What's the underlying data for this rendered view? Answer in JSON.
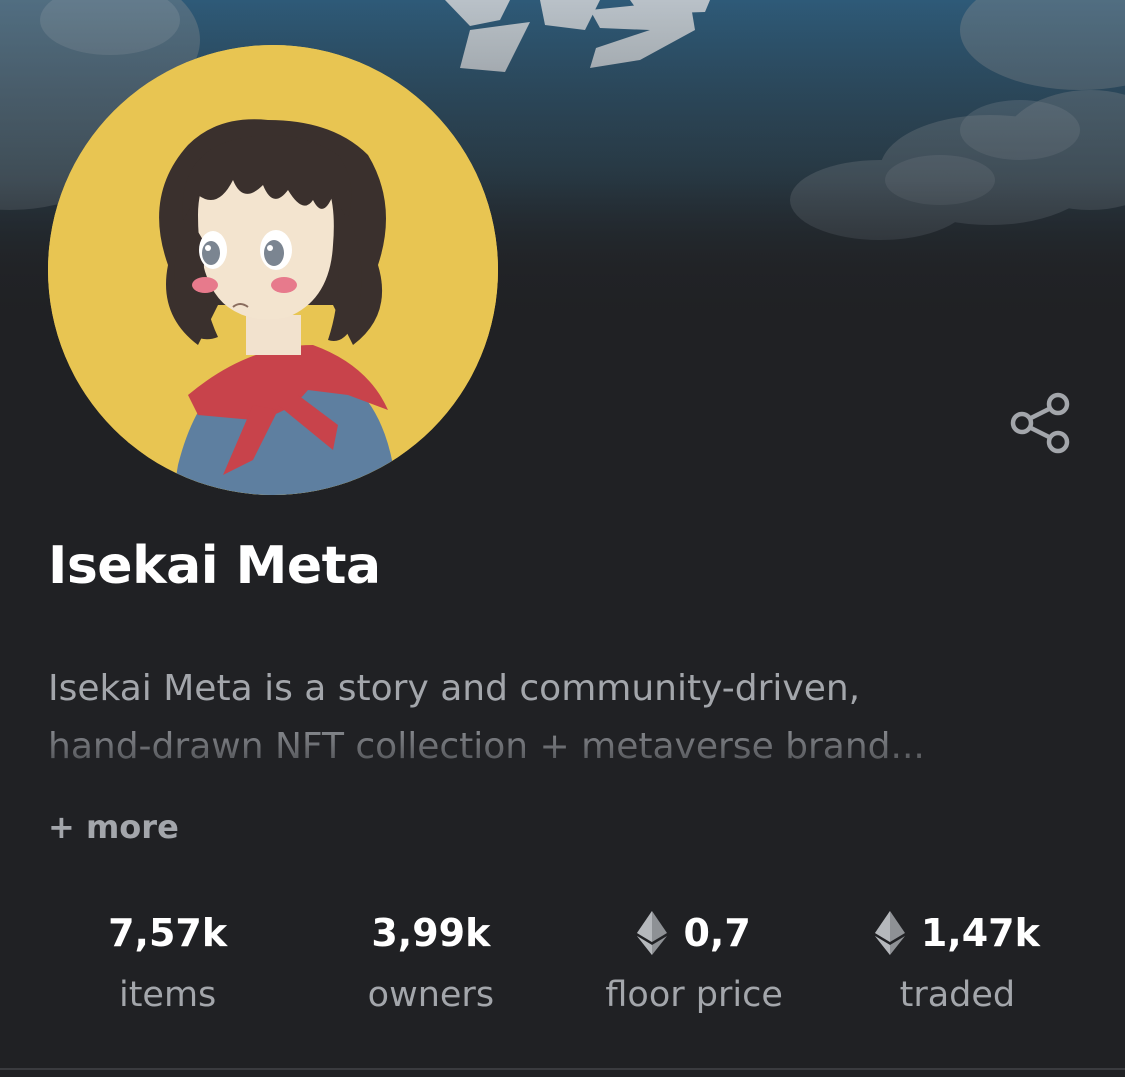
{
  "collection": {
    "name": "Isekai Meta",
    "description_line1": "Isekai Meta is a story and community-driven,",
    "description_line2": "hand-drawn NFT collection + metaverse brand...",
    "more_label": "+ more"
  },
  "stats": [
    {
      "value": "7,57k",
      "label": "items",
      "icon": null
    },
    {
      "value": "3,99k",
      "label": "owners",
      "icon": null
    },
    {
      "value": "0,7",
      "label": "floor price",
      "icon": "ethereum-icon"
    },
    {
      "value": "1,47k",
      "label": "traded",
      "icon": "ethereum-icon"
    }
  ],
  "colors": {
    "background": "#202124",
    "avatar_bg": "#e8c552",
    "text_primary": "#ffffff",
    "text_secondary": "#a3a6ab"
  },
  "icons": {
    "share": "share-icon",
    "currency": "ethereum-icon"
  }
}
